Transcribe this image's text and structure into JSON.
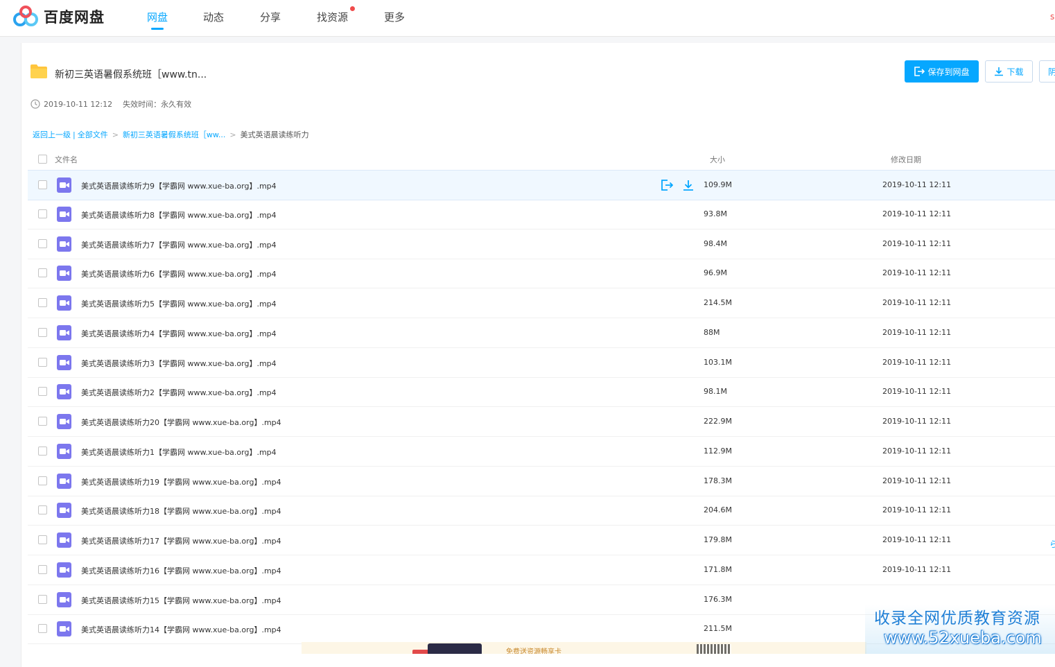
{
  "colors": {
    "accent": "#06a7ff",
    "video_icon": "#7c77ee",
    "notify_dot": "#f04b4b"
  },
  "header": {
    "logo_text": "百度网盘",
    "nav": [
      {
        "label": "网盘",
        "active": true
      },
      {
        "label": "动态"
      },
      {
        "label": "分享"
      },
      {
        "label": "找资源",
        "has_dot": true
      },
      {
        "label": "更多"
      }
    ],
    "corner_text": "s"
  },
  "share": {
    "title": "新初三英语暑假系统班［www.tn...",
    "save_button": "保存到网盘",
    "download_button": "下载",
    "more_button": "阴",
    "created": "2019-10-11 12:12",
    "expire_label": "失效时间：",
    "expire_value": "永久有效"
  },
  "breadcrumb": {
    "back": "返回上一级",
    "separator": "|",
    "all_files": "全部文件",
    "folder": "新初三英语暑假系统班［ww...",
    "arrow": ">",
    "current": "美式英语晨读练听力"
  },
  "table": {
    "headers": {
      "name": "文件名",
      "size": "大小",
      "date": "修改日期"
    },
    "rows": [
      {
        "name": "美式英语晨读练听力9【学霸网 www.xue-ba.org】.mp4",
        "size": "109.9M",
        "date": "2019-10-11 12:11"
      },
      {
        "name": "美式英语晨读练听力8【学霸网 www.xue-ba.org】.mp4",
        "size": "93.8M",
        "date": "2019-10-11 12:11"
      },
      {
        "name": "美式英语晨读练听力7【学霸网 www.xue-ba.org】.mp4",
        "size": "98.4M",
        "date": "2019-10-11 12:11"
      },
      {
        "name": "美式英语晨读练听力6【学霸网 www.xue-ba.org】.mp4",
        "size": "96.9M",
        "date": "2019-10-11 12:11"
      },
      {
        "name": "美式英语晨读练听力5【学霸网 www.xue-ba.org】.mp4",
        "size": "214.5M",
        "date": "2019-10-11 12:11"
      },
      {
        "name": "美式英语晨读练听力4【学霸网 www.xue-ba.org】.mp4",
        "size": "88M",
        "date": "2019-10-11 12:11"
      },
      {
        "name": "美式英语晨读练听力3【学霸网 www.xue-ba.org】.mp4",
        "size": "103.1M",
        "date": "2019-10-11 12:11"
      },
      {
        "name": "美式英语晨读练听力2【学霸网 www.xue-ba.org】.mp4",
        "size": "98.1M",
        "date": "2019-10-11 12:11"
      },
      {
        "name": "美式英语晨读练听力20【学霸网 www.xue-ba.org】.mp4",
        "size": "222.9M",
        "date": "2019-10-11 12:11"
      },
      {
        "name": "美式英语晨读练听力1【学霸网 www.xue-ba.org】.mp4",
        "size": "112.9M",
        "date": "2019-10-11 12:11"
      },
      {
        "name": "美式英语晨读练听力19【学霸网 www.xue-ba.org】.mp4",
        "size": "178.3M",
        "date": "2019-10-11 12:11"
      },
      {
        "name": "美式英语晨读练听力18【学霸网 www.xue-ba.org】.mp4",
        "size": "204.6M",
        "date": "2019-10-11 12:11"
      },
      {
        "name": "美式英语晨读练听力17【学霸网 www.xue-ba.org】.mp4",
        "size": "179.8M",
        "date": "2019-10-11 12:11"
      },
      {
        "name": "美式英语晨读练听力16【学霸网 www.xue-ba.org】.mp4",
        "size": "171.8M",
        "date": "2019-10-11 12:11"
      },
      {
        "name": "美式英语晨读练听力15【学霸网 www.xue-ba.org】.mp4",
        "size": "176.3M",
        "date": ""
      },
      {
        "name": "美式英语晨读练听力14【学霸网 www.xue-ba.org】.mp4",
        "size": "211.5M",
        "date": ""
      }
    ]
  },
  "banner": {
    "text": "免费送资源畅享卡"
  },
  "watermark": {
    "line1": "收录全网优质教育资源",
    "line2": "www.52xueba.com"
  },
  "edge_glyph": "ら"
}
